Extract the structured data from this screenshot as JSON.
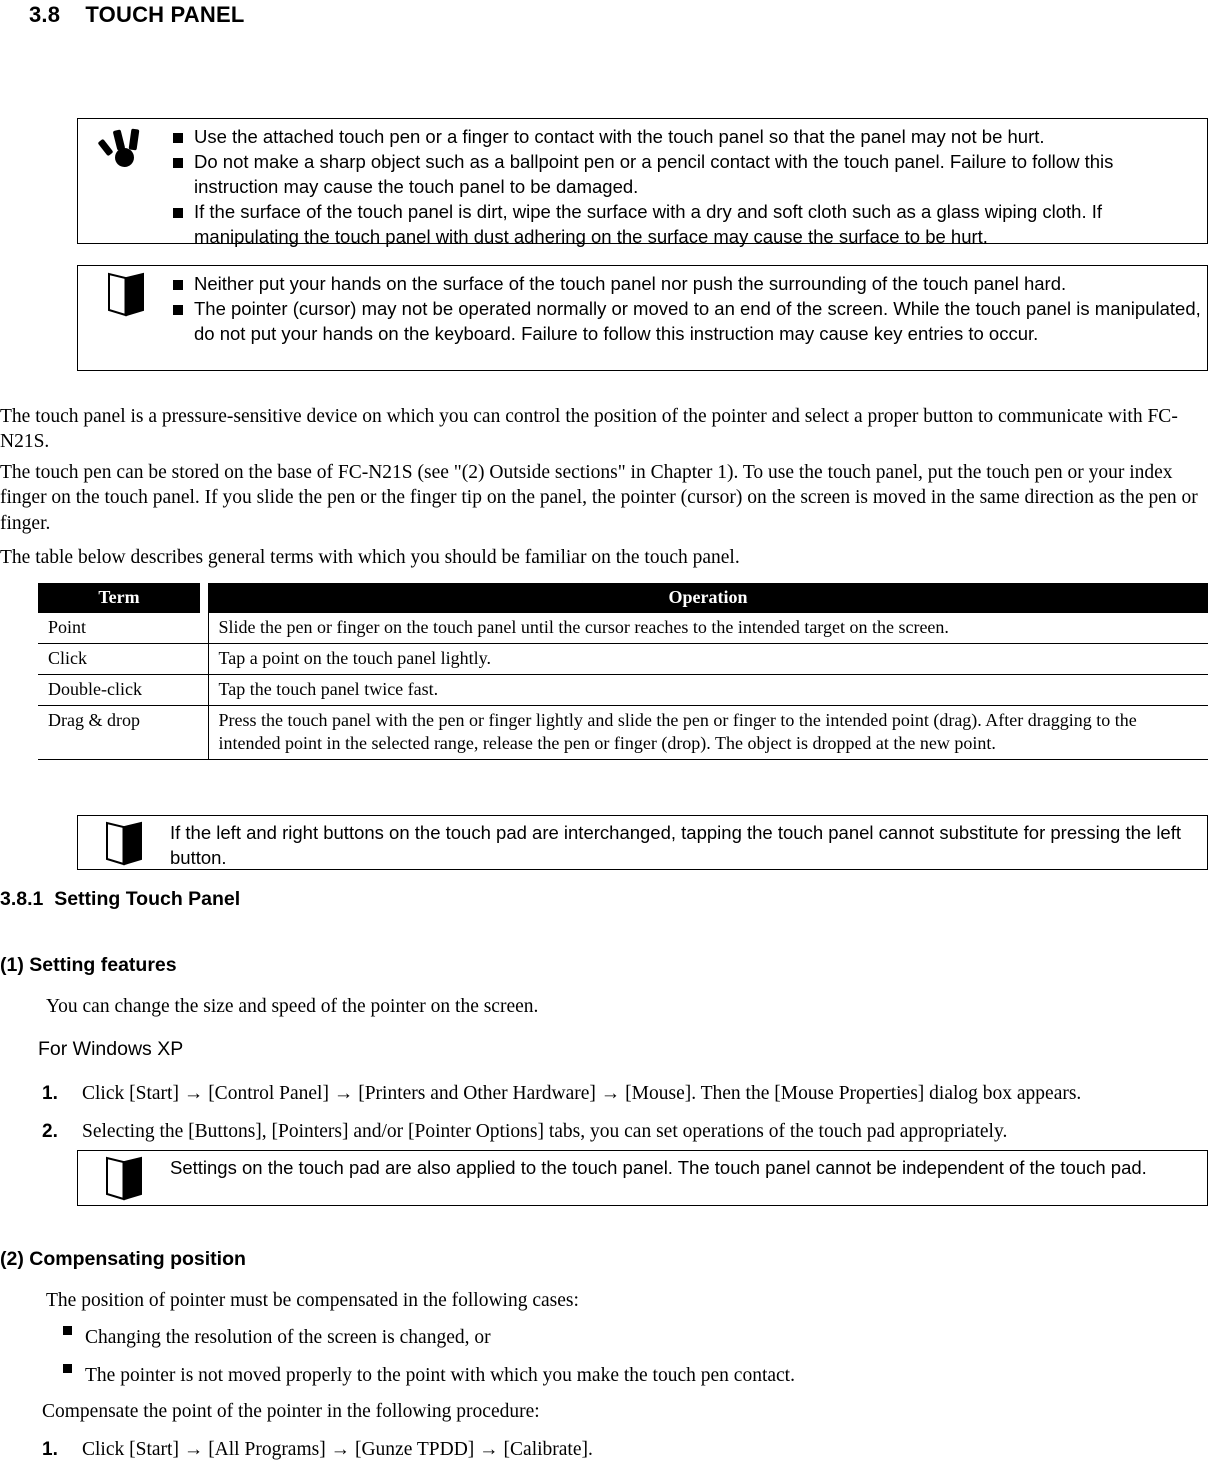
{
  "document": {
    "section_number": "3.8",
    "section_title": "TOUCH PANEL",
    "section_heading": "3.8    TOUCH PANEL"
  },
  "caution_box": {
    "icon": "caution-exclamation-icon",
    "bullets": [
      "Use the attached touch pen or a finger to contact with the touch panel so that the panel may not be hurt.",
      "Do not make a sharp object such as a ballpoint pen or a pencil contact with the touch panel. Failure to follow this instruction may cause the touch panel to be damaged.",
      "If the surface of the touch panel is dirt, wipe the surface with a dry and soft cloth such as a glass wiping cloth. If manipulating the touch panel with dust adhering on the surface may cause the surface to be hurt."
    ]
  },
  "note_box_1": {
    "icon": "open-book-note-icon",
    "bullets": [
      "Neither put your hands on the surface of the touch panel nor push the surrounding of the touch panel hard.",
      "The pointer (cursor) may not be operated normally or moved to an end of the screen. While the touch panel is manipulated, do not put your hands on the keyboard. Failure to follow this instruction may cause key entries to occur."
    ]
  },
  "paragraphs": {
    "p1": "The touch panel is a pressure-sensitive device on which you can control the position of the pointer and select a proper button to communicate with FC-N21S.",
    "p2": "The touch pen can be stored on the base of FC-N21S (see \"(2) Outside sections\" in Chapter 1). To use the touch panel, put the touch pen or your index finger on the touch panel. If you slide the pen or the finger tip on the panel, the pointer (cursor) on the screen is moved in the same direction as the pen or finger.",
    "p3": "The table below describes general terms with which you should be familiar on the touch panel."
  },
  "terms_table": {
    "headers": [
      "Term",
      "Operation"
    ],
    "rows": [
      {
        "term": "Point",
        "operation": "Slide the pen or finger on the touch panel until the cursor reaches to the intended target on the screen."
      },
      {
        "term": "Click",
        "operation": "Tap a point on the touch panel lightly."
      },
      {
        "term": "Double-click",
        "operation": "Tap the touch panel twice fast."
      },
      {
        "term": "Drag & drop",
        "operation": "Press the touch panel with the pen or finger lightly and slide the pen or finger to the intended point (drag). After dragging to the intended point in the selected range, release the pen or finger (drop). The object is dropped at the new point."
      }
    ]
  },
  "note_box_2": {
    "icon": "open-book-note-icon",
    "text": "If the left and right buttons on the touch pad are interchanged, tapping the touch panel cannot substitute for pressing the left button."
  },
  "subsection": {
    "heading": "3.8.1  Setting Touch Panel"
  },
  "setting_features": {
    "heading": "(1) Setting features",
    "intro": "You can change the size and speed of the pointer on the screen.",
    "os_label": "For Windows XP",
    "steps": [
      {
        "num": "1.",
        "text": "Click [Start] → [Control Panel] → [Printers and Other Hardware] → [Mouse]. Then the [Mouse Properties] dialog box appears."
      },
      {
        "num": "2.",
        "text": "Selecting the [Buttons], [Pointers] and/or [Pointer Options] tabs, you can set operations of the touch pad appropriately."
      }
    ]
  },
  "note_box_3": {
    "icon": "open-book-note-icon",
    "text": "Settings on the touch pad are also applied to the touch panel. The touch panel cannot be independent of the touch pad."
  },
  "compensating_position": {
    "heading": "(2) Compensating position",
    "intro": "The position of pointer must be compensated in the following cases:",
    "bullets": [
      "Changing the resolution of the screen is changed, or",
      "The pointer is not moved properly to the point with which you make the touch pen contact."
    ],
    "procedure_intro": "Compensate the point of the pointer in the following procedure:",
    "steps": [
      {
        "num": "1.",
        "text": "Click [Start] → [All Programs] → [Gunze TPDD] → [Calibrate]."
      }
    ]
  },
  "colors": {
    "text": "#000000",
    "background": "#ffffff",
    "table_header_bg": "#000000",
    "table_header_text": "#ffffff"
  }
}
